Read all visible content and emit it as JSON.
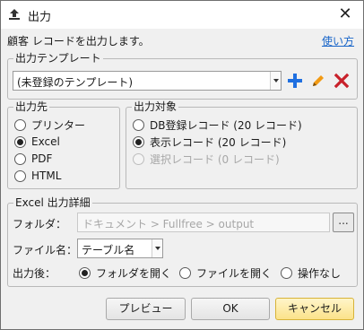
{
  "window": {
    "title": "出力",
    "close_glyph": "✕"
  },
  "description": "顧客 レコードを出力します。",
  "help_link": "使い方",
  "template": {
    "legend": "出力テンプレート",
    "selected": "(未登録のテンプレート)",
    "icons": [
      "add-icon",
      "edit-icon",
      "delete-icon"
    ],
    "colors": {
      "add": "#1f6fe0",
      "edit": "#f29a13",
      "delete": "#c8202a"
    }
  },
  "destination": {
    "legend": "出力先",
    "options": [
      {
        "label": "プリンター",
        "selected": false
      },
      {
        "label": "Excel",
        "selected": true
      },
      {
        "label": "PDF",
        "selected": false
      },
      {
        "label": "HTML",
        "selected": false
      }
    ]
  },
  "target": {
    "legend": "出力対象",
    "options": [
      {
        "label": "DB登録レコード (20 レコード)",
        "selected": false,
        "disabled": false
      },
      {
        "label": "表示レコード (20 レコード)",
        "selected": true,
        "disabled": false
      },
      {
        "label": "選択レコード (0 レコード)",
        "selected": false,
        "disabled": true
      }
    ]
  },
  "excel_details": {
    "legend": "Excel 出力詳細",
    "folder_label": "フォルダ：",
    "folder_value": "ドキュメント > Fullfree > output",
    "browse_label": "...",
    "filename_label": "ファイル名：",
    "filename_value": "テーブル名",
    "after_label": "出力後：",
    "after_options": [
      {
        "label": "フォルダを開く",
        "selected": true
      },
      {
        "label": "ファイルを開く",
        "selected": false
      },
      {
        "label": "操作なし",
        "selected": false
      }
    ]
  },
  "buttons": {
    "preview": "プレビュー",
    "ok": "OK",
    "cancel": "キャンセル"
  }
}
